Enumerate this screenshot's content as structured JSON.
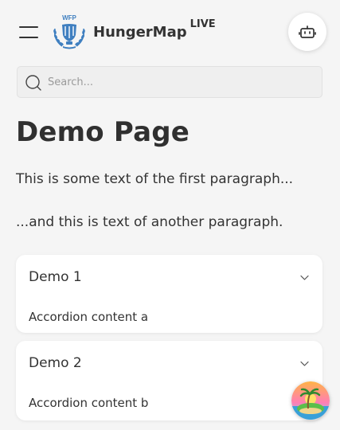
{
  "header": {
    "brand_name": "HungerMap",
    "brand_suffix": "LIVE",
    "logo_label": "WFP",
    "menu_icon": "hamburger-icon",
    "chat_icon": "robot-icon"
  },
  "search": {
    "placeholder": "Search...",
    "value": ""
  },
  "page": {
    "title": "Demo Page",
    "paragraphs": [
      "This is some text of the first paragraph...",
      "...and this is text of another paragraph."
    ]
  },
  "accordions": [
    {
      "title": "Demo 1",
      "content": "Accordion content a",
      "expanded": true
    },
    {
      "title": "Demo 2",
      "content": "Accordion content b",
      "expanded": true
    }
  ],
  "colors": {
    "background": "#f5f5f5",
    "logo_blue": "#3f7fc0",
    "text": "#333333"
  }
}
